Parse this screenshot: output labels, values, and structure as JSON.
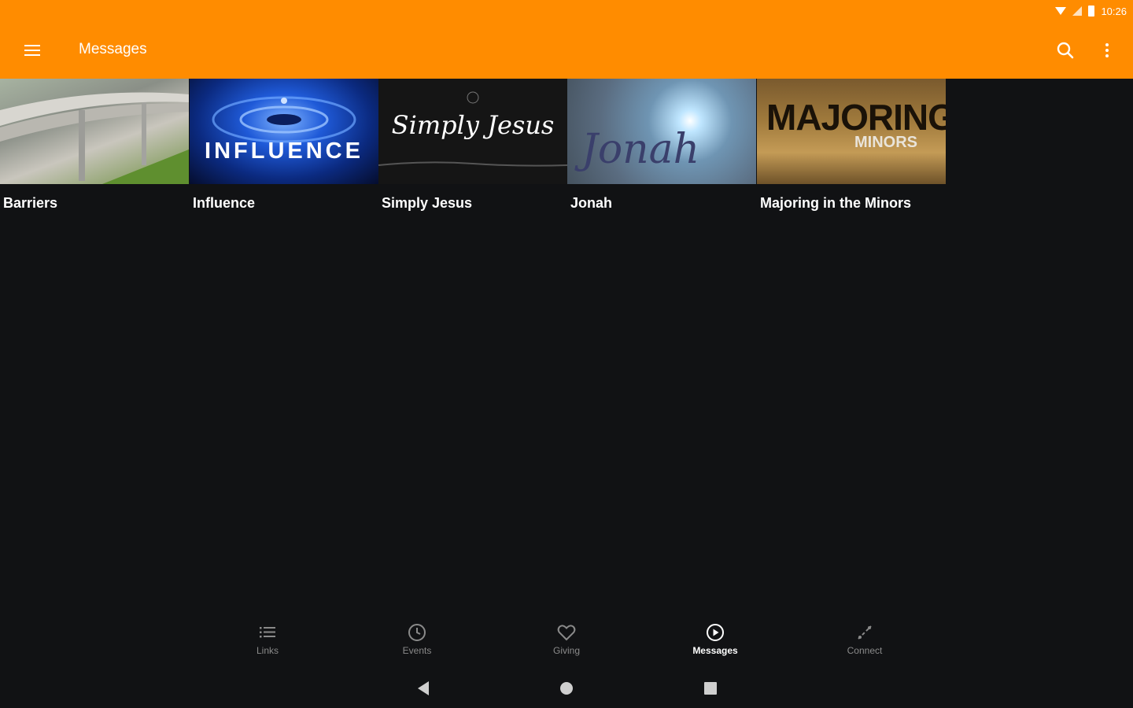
{
  "status_bar": {
    "time": "10:26"
  },
  "app_bar": {
    "title": "Messages"
  },
  "series": [
    {
      "label": "Barriers"
    },
    {
      "label": "Influence",
      "thumb_text": "INFLUENCE"
    },
    {
      "label": "Simply Jesus",
      "thumb_text": "Simply Jesus"
    },
    {
      "label": "Jonah",
      "thumb_text": "Jonah"
    },
    {
      "label": "Majoring in the Minors",
      "thumb_text_top": "MAJORING",
      "thumb_text_bottom": "MINORS"
    }
  ],
  "bottom_nav": [
    {
      "label": "Links",
      "icon": "list-icon"
    },
    {
      "label": "Events",
      "icon": "clock-icon"
    },
    {
      "label": "Giving",
      "icon": "heart-icon"
    },
    {
      "label": "Messages",
      "icon": "play-circle-icon",
      "active": true
    },
    {
      "label": "Connect",
      "icon": "connect-icon"
    }
  ],
  "colors": {
    "accent": "#ff8c00",
    "background": "#111214",
    "inactive": "#8a8a8a"
  }
}
